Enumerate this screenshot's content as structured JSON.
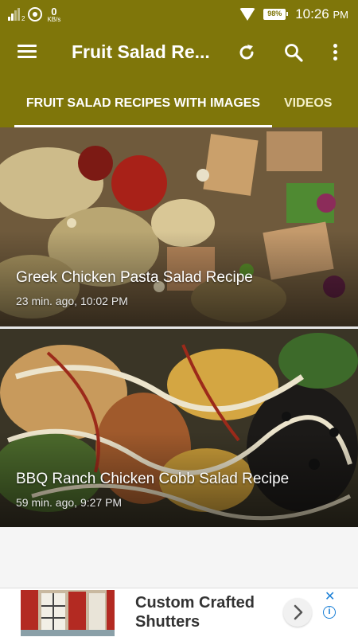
{
  "status_bar": {
    "sim_index": "2",
    "network_speed": "0",
    "network_unit": "KB/s",
    "battery": "98%",
    "battery_level_pct": 98,
    "time": "10:26",
    "ampm": "PM"
  },
  "toolbar": {
    "title": "Fruit Salad Re..."
  },
  "tabs": [
    {
      "label": "FRUIT SALAD RECIPES WITH IMAGES",
      "selected": true
    },
    {
      "label": "VIDEOS",
      "selected": false
    }
  ],
  "recipes": [
    {
      "title": "Greek Chicken Pasta Salad Recipe",
      "meta": "23 min. ago, 10:02 PM"
    },
    {
      "title": "BBQ Ranch Chicken Cobb Salad Recipe",
      "meta": "59 min. ago, 9:27 PM"
    }
  ],
  "ad": {
    "headline": "Custom Crafted Shutters",
    "close_glyph": "✕",
    "info_glyph": "i"
  },
  "colors": {
    "app_bar": "#7f760a",
    "tab_indicator": "#ffffff",
    "ad_accent": "#1a7fd6"
  },
  "icons": [
    "menu-icon",
    "refresh-icon",
    "search-icon",
    "more-vert-icon",
    "chevron-right-icon",
    "close-icon",
    "info-icon",
    "wifi-icon",
    "battery-icon",
    "signal-icon",
    "whatsapp-icon"
  ]
}
